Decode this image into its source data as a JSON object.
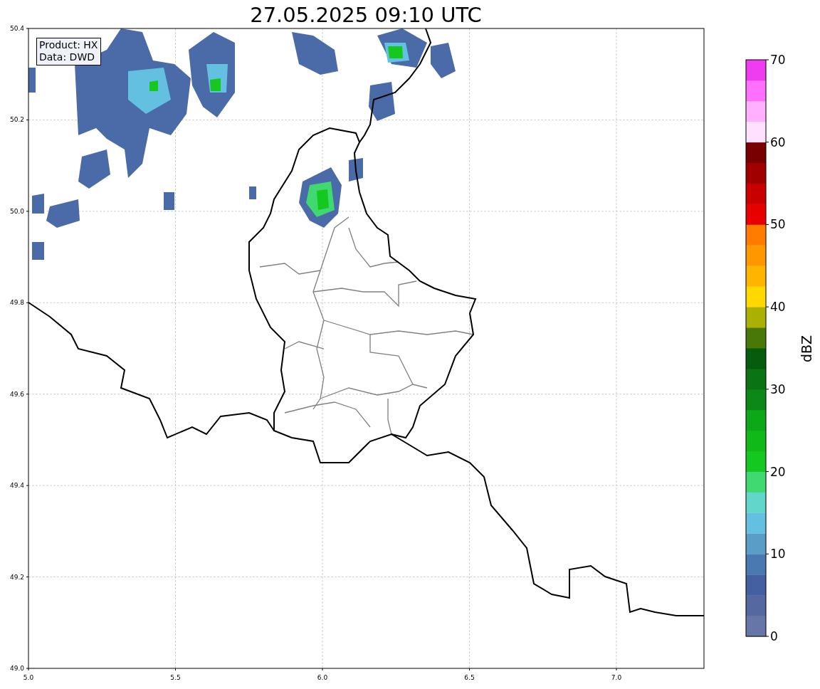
{
  "title": "27.05.2025 09:10 UTC",
  "info_box": {
    "lines": [
      "Product: HX",
      "Data: DWD"
    ]
  },
  "map": {
    "xtick_labels": [
      "5.0",
      "5.5",
      "6.0",
      "6.5",
      "7.0"
    ],
    "ytick_labels": [
      "50.4",
      "50.2",
      "50.0",
      "49.8",
      "49.6",
      "49.4",
      "49.2",
      "49.0"
    ]
  },
  "colorbar": {
    "label": "dBZ",
    "tick_labels": [
      "70",
      "60",
      "50",
      "40",
      "30",
      "20",
      "10",
      "0"
    ],
    "segments": [
      {
        "color": "#6676a6"
      },
      {
        "color": "#5568a0"
      },
      {
        "color": "#4560a0"
      },
      {
        "color": "#4a78b0"
      },
      {
        "color": "#5a9ec8"
      },
      {
        "color": "#64c0e0"
      },
      {
        "color": "#62d6c8"
      },
      {
        "color": "#40d870"
      },
      {
        "color": "#14c820"
      },
      {
        "color": "#10b818"
      },
      {
        "color": "#0ca818"
      },
      {
        "color": "#0c8818"
      },
      {
        "color": "#0a7414"
      },
      {
        "color": "#065c0c"
      },
      {
        "color": "#4a7808"
      },
      {
        "color": "#aab004"
      },
      {
        "color": "#ffd800"
      },
      {
        "color": "#ffb400"
      },
      {
        "color": "#ff9800"
      },
      {
        "color": "#ff7c00"
      },
      {
        "color": "#e80000"
      },
      {
        "color": "#c80000"
      },
      {
        "color": "#a00000"
      },
      {
        "color": "#780000"
      },
      {
        "color": "#ffe0ff"
      },
      {
        "color": "#ffb0ff"
      },
      {
        "color": "#ff70ff"
      },
      {
        "color": "#f03cf0"
      }
    ]
  }
}
